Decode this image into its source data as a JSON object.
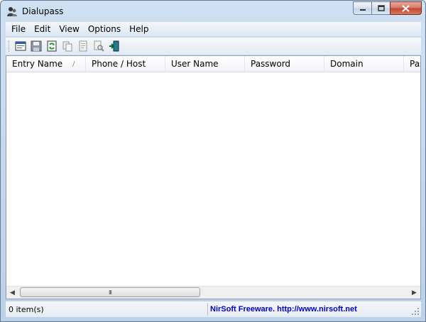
{
  "window": {
    "title": "Dialupass",
    "app_icon": "key-users-icon"
  },
  "menu": {
    "items": [
      "File",
      "Edit",
      "View",
      "Options",
      "Help"
    ]
  },
  "toolbar": {
    "buttons": [
      {
        "name": "properties",
        "icon": "window-properties-icon"
      },
      {
        "name": "save",
        "icon": "floppy-save-icon"
      },
      {
        "name": "refresh",
        "icon": "refresh-icon"
      },
      {
        "name": "copy",
        "icon": "copy-icon"
      },
      {
        "name": "html-report",
        "icon": "report-icon"
      },
      {
        "name": "find",
        "icon": "find-icon"
      },
      {
        "name": "exit",
        "icon": "exit-door-icon"
      }
    ]
  },
  "list": {
    "columns": [
      "Entry Name",
      "Phone / Host",
      "User Name",
      "Password",
      "Domain",
      "Pas"
    ],
    "sort_indicator": "/",
    "rows": [],
    "scroll_thumb_glyph": "III"
  },
  "status": {
    "count": "0 item(s)",
    "credit": "NirSoft Freeware.  http://www.nirsoft.net"
  },
  "colors": {
    "title_gradient": "#cfe0f3",
    "link_blue": "#0000cc",
    "close_red": "#c2442d"
  }
}
